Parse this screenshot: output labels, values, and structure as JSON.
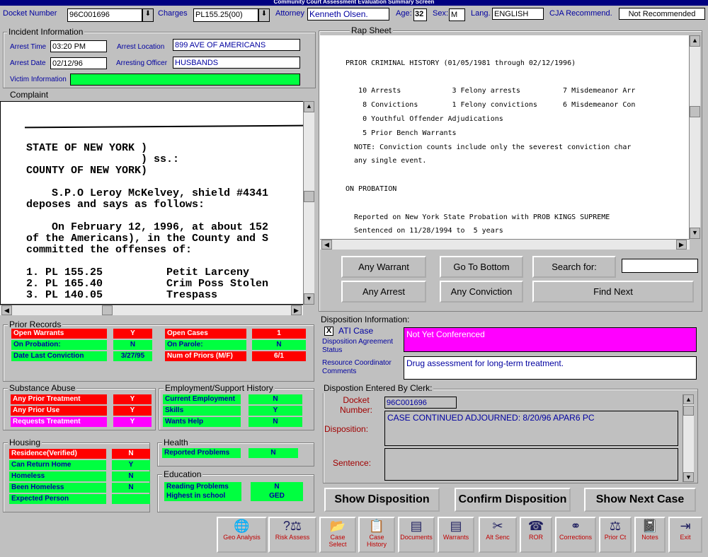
{
  "window": {
    "title": "Community Court Assessment Evaluation Summary Screen"
  },
  "header": {
    "docket_label": "Docket Number",
    "docket_value": "96C001696",
    "charges_label": "Charges",
    "charges_value": "PL155.25(00)",
    "attorney_label": "Attorney",
    "attorney_value": "Kenneth Olsen.",
    "age_label": "Age:",
    "age_value": "32",
    "sex_label": "Sex:",
    "sex_value": "M",
    "lang_label": "Lang.",
    "lang_value": "ENGLISH",
    "cja_label": "CJA Recommend.",
    "cja_value": "Not Recommended"
  },
  "incident": {
    "title": "Incident Information",
    "arrest_time_label": "Arrest Time",
    "arrest_time": "03:20 PM",
    "arrest_location_label": "Arrest Location",
    "arrest_location": "899 AVE OF AMERICANS",
    "arrest_date_label": "Arrest Date",
    "arrest_date": "02/12/96",
    "arresting_officer_label": "Arresting Officer",
    "arresting_officer": "HUSBANDS",
    "victim_label": "Victim Information",
    "victim": ""
  },
  "complaint": {
    "title": "Complaint",
    "lines": [
      "STATE OF NEW YORK )",
      "                  ) ss.:",
      "COUNTY OF NEW YORK)",
      "",
      "    S.P.O Leroy McKelvey, shield #4341",
      "deposes and says as follows:",
      "",
      "    On February 12, 1996, at about 152",
      "of the Americans), in the County and S",
      "committed the offenses of:",
      "",
      "1. PL 155.25          Petit Larceny",
      "2. PL 165.40          Crim Poss Stolen",
      "3. PL 140.05          Trespass"
    ]
  },
  "rap_sheet": {
    "title": "Rap Sheet",
    "lines": [
      "",
      "PRIOR CRIMINAL HISTORY (01/05/1981 through 02/12/1996)",
      "",
      "   10 Arrests            3 Felony arrests          7 Misdemeanor Arr",
      "    8 Convictions        1 Felony convictions      6 Misdemeanor Con",
      "    0 Youthful Offender Adjudications",
      "    5 Prior Bench Warrants",
      "  NOTE: Conviction counts include only the severest conviction char",
      "  any single event.",
      "",
      "ON PROBATION",
      "",
      "  Reported on New York State Probation with PROB KINGS SUPREME",
      "  Sentenced on 11/28/1994 to  5 years"
    ],
    "buttons": {
      "any_warrant": "Any Warrant",
      "go_to_bottom": "Go To Bottom",
      "search_for": "Search for:",
      "any_arrest": "Any Arrest",
      "any_conviction": "Any Conviction",
      "find_next": "Find Next"
    },
    "search_value": ""
  },
  "prior_records": {
    "title": "Prior Records",
    "left": [
      {
        "label": "Open Warrants",
        "value": "Y",
        "color": "red"
      },
      {
        "label": "On Probation:",
        "value": "N",
        "color": "green"
      },
      {
        "label": "Date Last Conviction",
        "value": "3/27/95",
        "color": "green"
      }
    ],
    "right": [
      {
        "label": "Open Cases",
        "value": "1",
        "color": "red"
      },
      {
        "label": "On Parole:",
        "value": "N",
        "color": "green"
      },
      {
        "label": "Num of Priors (M/F)",
        "value": "6/1",
        "color": "red"
      }
    ]
  },
  "substance": {
    "title": "Substance Abuse",
    "rows": [
      {
        "label": "Any Prior Treatment",
        "value": "Y",
        "color": "red"
      },
      {
        "label": "Any Prior Use",
        "value": "Y",
        "color": "red"
      },
      {
        "label": "Requests Treatment",
        "value": "Y",
        "color": "mag"
      }
    ]
  },
  "employment": {
    "title": "Employment/Support History",
    "rows": [
      {
        "label": "Current Employment",
        "value": "N",
        "color": "green"
      },
      {
        "label": "Skills",
        "value": "Y",
        "color": "green"
      },
      {
        "label": "Wants Help",
        "value": "N",
        "color": "green"
      }
    ]
  },
  "housing": {
    "title": "Housing",
    "rows": [
      {
        "label": "Residence(Verified)",
        "value": "N",
        "color": "red"
      },
      {
        "label": "Can Return Home",
        "value": "Y",
        "color": "green"
      },
      {
        "label": "Homeless",
        "value": "N",
        "color": "green"
      },
      {
        "label": "Been Homeless",
        "value": "N",
        "color": "green"
      },
      {
        "label": "Expected Person",
        "value": "",
        "color": "green"
      }
    ]
  },
  "health": {
    "title": "Health",
    "rows": [
      {
        "label": "Reported Problems",
        "value": "N",
        "color": "green"
      }
    ]
  },
  "education": {
    "title": "Education",
    "rows": [
      {
        "label": "Reading Problems",
        "value": "N",
        "color": "green"
      },
      {
        "label": "Highest in school",
        "value": "GED",
        "color": "green"
      }
    ]
  },
  "disposition": {
    "title": "Disposition Information:",
    "ati_check": "X",
    "ati_label": "ATI Case",
    "agreement_label": "Disposition Agreement Status",
    "agreement_value": "Not Yet Conferenced",
    "rc_label": "Resource Coordinator Comments",
    "rc_value": "Drug assessment for long-term treatment.",
    "clerk_title": "Dispostion Entered By Clerk:",
    "docket_label": "Docket Number:",
    "docket_value": "96C001696",
    "disp_label": "Disposition:",
    "disp_value": "CASE CONTINUED ADJOURNED: 8/20/96 APAR6 PC",
    "sentence_label": "Sentence:",
    "sentence_value": "",
    "show_disposition": "Show Disposition",
    "confirm_disposition": "Confirm Disposition",
    "show_next_case": "Show Next Case"
  },
  "toolbar": [
    {
      "label": "Geo Analysis",
      "icon": "globe-icon",
      "glyph": "🌐"
    },
    {
      "label": "Risk Assess",
      "icon": "risk-icon",
      "glyph": "?⚖"
    },
    {
      "label": "Case Select",
      "icon": "folder-icon",
      "glyph": "📂"
    },
    {
      "label": "Case History",
      "icon": "history-icon",
      "glyph": "📋"
    },
    {
      "label": "Documents",
      "icon": "documents-icon",
      "glyph": "▤"
    },
    {
      "label": "Warrants",
      "icon": "warrants-icon",
      "glyph": "▤"
    },
    {
      "label": "Alt Senc",
      "icon": "alt-sentence-icon",
      "glyph": "✂"
    },
    {
      "label": "ROR",
      "icon": "phone-icon",
      "glyph": "☎"
    },
    {
      "label": "Corrections",
      "icon": "corrections-icon",
      "glyph": "⚭"
    },
    {
      "label": "Prior Ct",
      "icon": "scales-icon",
      "glyph": "⚖"
    },
    {
      "label": "Notes",
      "icon": "notes-icon",
      "glyph": "📓"
    },
    {
      "label": "Exit",
      "icon": "exit-icon",
      "glyph": "⇥"
    }
  ]
}
